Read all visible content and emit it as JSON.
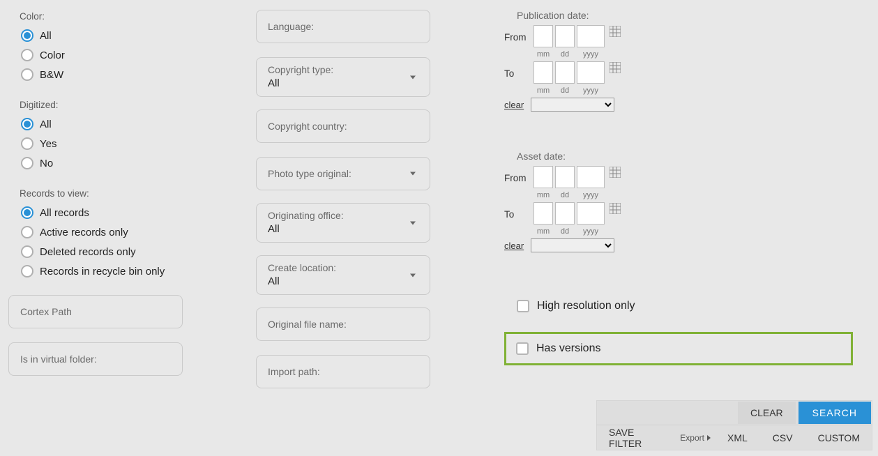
{
  "left": {
    "color": {
      "label": "Color:",
      "options": [
        "All",
        "Color",
        "B&W"
      ],
      "selected": 0
    },
    "digitized": {
      "label": "Digitized:",
      "options": [
        "All",
        "Yes",
        "No"
      ],
      "selected": 0
    },
    "records": {
      "label": "Records to view:",
      "options": [
        "All records",
        "Active records only",
        "Deleted records only",
        "Records in recycle bin only"
      ],
      "selected": 0
    },
    "cortex_path": {
      "label": "Cortex Path"
    },
    "virtual_folder": {
      "label": "Is in virtual folder:"
    }
  },
  "mid": {
    "language": {
      "label": "Language:"
    },
    "copyright_type": {
      "label": "Copyright type:",
      "value": "All"
    },
    "copyright_country": {
      "label": "Copyright country:"
    },
    "photo_type": {
      "label": "Photo type original:"
    },
    "orig_office": {
      "label": "Originating office:",
      "value": "All"
    },
    "create_location": {
      "label": "Create location:",
      "value": "All"
    },
    "orig_file": {
      "label": "Original file name:"
    },
    "import_path": {
      "label": "Import path:"
    }
  },
  "right": {
    "pub_date": {
      "title": "Publication date:",
      "from": "From",
      "to": "To",
      "mm": "mm",
      "dd": "dd",
      "yyyy": "yyyy",
      "clear": "clear"
    },
    "asset_date": {
      "title": "Asset date:",
      "from": "From",
      "to": "To",
      "mm": "mm",
      "dd": "dd",
      "yyyy": "yyyy",
      "clear": "clear"
    },
    "hires": "High resolution only",
    "has_versions": "Has versions"
  },
  "bar": {
    "clear": "CLEAR",
    "search": "SEARCH",
    "save_filter": "SAVE FILTER",
    "export": "Export",
    "xml": "XML",
    "csv": "CSV",
    "custom": "CUSTOM"
  }
}
